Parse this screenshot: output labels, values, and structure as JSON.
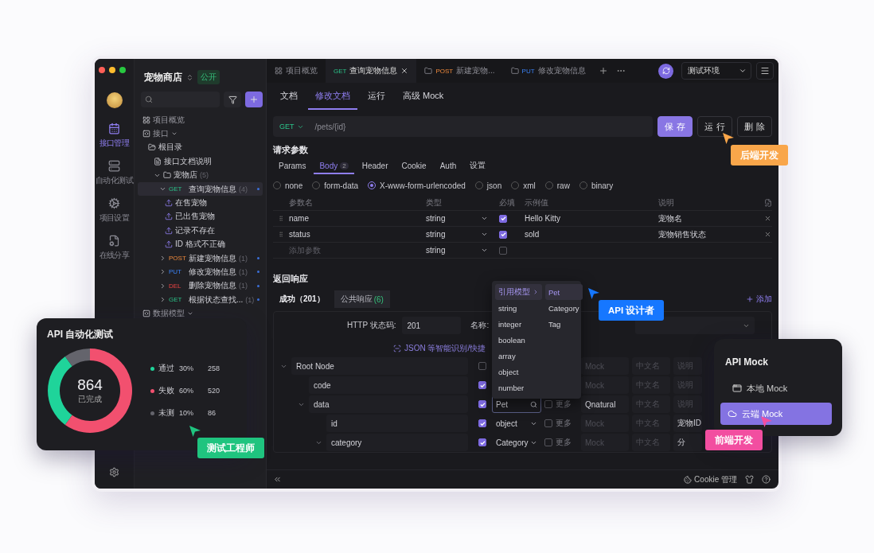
{
  "project": {
    "name": "宠物商店",
    "visibility": "公开"
  },
  "rail": [
    {
      "label": "接口管理",
      "selected": true
    },
    {
      "label": "自动化测试",
      "selected": false
    },
    {
      "label": "项目设置",
      "selected": false
    },
    {
      "label": "在线分享",
      "selected": false
    }
  ],
  "tree": [
    {
      "kind": "overview",
      "label": "项目概览"
    },
    {
      "kind": "section",
      "label": "接口",
      "children": [
        {
          "kind": "root",
          "label": "根目录",
          "children": [
            {
              "kind": "doc",
              "label": "接口文档说明"
            },
            {
              "kind": "folder",
              "label": "宠物店",
              "count": "(5)",
              "expanded": true,
              "children": [
                {
                  "kind": "api",
                  "method": "GET",
                  "label": "查询宠物信息",
                  "count": "(4)",
                  "expanded": true,
                  "selected": true,
                  "children": [
                    {
                      "kind": "case",
                      "label": "在售宠物"
                    },
                    {
                      "kind": "case",
                      "label": "已出售宠物"
                    },
                    {
                      "kind": "case",
                      "label": "记录不存在"
                    },
                    {
                      "kind": "case",
                      "label": "ID 格式不正确"
                    }
                  ]
                },
                {
                  "kind": "api",
                  "method": "POST",
                  "label": "新建宠物信息",
                  "count": "(1)",
                  "expanded": false,
                  "selected": false
                },
                {
                  "kind": "api",
                  "method": "PUT",
                  "label": "修改宠物信息",
                  "count": "(1)",
                  "expanded": false,
                  "selected": false
                },
                {
                  "kind": "api",
                  "method": "DEL",
                  "label": "删除宠物信息",
                  "count": "(1)",
                  "expanded": false,
                  "selected": false
                },
                {
                  "kind": "api",
                  "method": "GET",
                  "label": "根据状态查找...",
                  "count": "(1)",
                  "expanded": false,
                  "selected": false
                }
              ]
            }
          ]
        }
      ]
    },
    {
      "kind": "section",
      "label": "数据模型"
    }
  ],
  "tabs": [
    {
      "kind": "overview",
      "label": "项目概览",
      "selected": false
    },
    {
      "kind": "api",
      "method": "GET",
      "label": "查询宠物信息",
      "selected": true
    },
    {
      "kind": "folder",
      "method": "POST",
      "label": "新建宠物...",
      "selected": false
    },
    {
      "kind": "folder",
      "method": "PUT",
      "label": "修改宠物信息",
      "selected": false
    }
  ],
  "environment": "测试环境",
  "doc_tabs": [
    {
      "label": "文档",
      "selected": false
    },
    {
      "label": "修改文档",
      "selected": true
    },
    {
      "label": "运行",
      "selected": false
    },
    {
      "label": "高级 Mock",
      "selected": false
    }
  ],
  "request": {
    "method": "GET",
    "path": "/pets/{id}",
    "buttons": [
      {
        "label": "保 存",
        "kind": "primary"
      },
      {
        "label": "运 行",
        "kind": "default"
      },
      {
        "label": "删 除",
        "kind": "default"
      }
    ]
  },
  "request_params": {
    "title": "请求参数",
    "tabs": [
      {
        "label": "Params",
        "selected": false
      },
      {
        "label": "Body",
        "badge": "2",
        "selected": true
      },
      {
        "label": "Header",
        "selected": false
      },
      {
        "label": "Cookie",
        "selected": false
      },
      {
        "label": "Auth",
        "selected": false
      },
      {
        "label": "设置",
        "selected": false
      }
    ],
    "body_types": [
      {
        "label": "none",
        "selected": false
      },
      {
        "label": "form-data",
        "selected": false
      },
      {
        "label": "X-www-form-urlencoded",
        "selected": true
      },
      {
        "label": "json",
        "selected": false
      },
      {
        "label": "xml",
        "selected": false
      },
      {
        "label": "raw",
        "selected": false
      },
      {
        "label": "binary",
        "selected": false
      }
    ],
    "columns": [
      "参数名",
      "类型",
      "必填",
      "示例值",
      "说明"
    ],
    "rows": [
      {
        "name": "name",
        "type": "string",
        "required": true,
        "example": "Hello Kitty",
        "description": "宠物名"
      },
      {
        "name": "status",
        "type": "string",
        "required": true,
        "example": "sold",
        "description": "宠物销售状态"
      }
    ],
    "new_row": {
      "placeholder": "添加参数",
      "type": "string",
      "required": false
    }
  },
  "response": {
    "title": "返回响应",
    "tabs": [
      {
        "label": "成功（201）",
        "selected": true
      },
      {
        "label": "公共响应",
        "count": "(6)",
        "selected": false
      }
    ],
    "add_label": "添加",
    "status_label": "HTTP 状态码:",
    "status_value": "201",
    "name_label": "名称:",
    "import_hint": "JSON 等智能识别/快捷",
    "schema": [
      {
        "name": "Root Node",
        "expanded": true,
        "required": false,
        "mock_placeholder": "Mock",
        "cn_placeholder": "中文名",
        "desc_placeholder": "说明",
        "children": [
          {
            "name": "code",
            "required": true,
            "mock_placeholder": "Mock",
            "cn_placeholder": "中文名",
            "desc_placeholder": "说明"
          },
          {
            "name": "data",
            "expanded": true,
            "required": true,
            "type": {
              "kind": "search",
              "value": "Pet"
            },
            "more": {
              "label": "更多",
              "checked": false
            },
            "mock": "Qnatural",
            "cn_placeholder": "中文名",
            "desc_placeholder": "说明",
            "children": [
              {
                "name": "id",
                "required": true,
                "type": {
                  "kind": "select",
                  "value": "object"
                },
                "more": {
                  "label": "更多",
                  "checked": false
                },
                "mock_placeholder": "Mock",
                "cn_placeholder": "中文名",
                "desc": "宠物ID"
              },
              {
                "name": "category",
                "expanded": true,
                "required": true,
                "type": {
                  "kind": "select",
                  "value": "Category"
                },
                "more": {
                  "label": "更多",
                  "checked": false
                },
                "mock_placeholder": "Mock",
                "cn_placeholder": "中文名",
                "desc": "分"
              }
            ]
          }
        ]
      }
    ]
  },
  "type_menu": {
    "left": [
      {
        "label": "引用模型",
        "selected": true
      },
      {
        "label": "string",
        "selected": false
      },
      {
        "label": "integer",
        "selected": false
      },
      {
        "label": "boolean",
        "selected": false
      },
      {
        "label": "array",
        "selected": false
      },
      {
        "label": "object",
        "selected": false
      },
      {
        "label": "number",
        "selected": false
      }
    ],
    "right": [
      {
        "label": "Pet",
        "selected": true
      },
      {
        "label": "Category",
        "selected": false
      },
      {
        "label": "Tag",
        "selected": false
      }
    ]
  },
  "footer": {
    "cookie": "Cookie 管理"
  },
  "test_card": {
    "title": "API 自动化测试",
    "total": "864",
    "total_label": "已完成",
    "chart_data": {
      "type": "donut",
      "categories": [
        "通过",
        "失败",
        "未测"
      ],
      "values": [
        30,
        60,
        10
      ]
    },
    "legend": [
      {
        "percent": "30%",
        "count": "258",
        "color": "#1fd49a"
      },
      {
        "percent": "60%",
        "count": "520",
        "color": "#f2506f"
      },
      {
        "percent": "10%",
        "count": "86",
        "color": "#64646c"
      }
    ]
  },
  "mock_card": {
    "title": "API Mock",
    "items": [
      {
        "label": "本地 Mock",
        "selected": false
      },
      {
        "label": "云端 Mock",
        "selected": true
      }
    ]
  },
  "roles": [
    {
      "label": "后端开发",
      "color": "#f9a64a"
    },
    {
      "label": "API 设计者",
      "color": "#1677ff"
    },
    {
      "label": "测试工程师",
      "color": "#1fc47f"
    },
    {
      "label": "前端开发",
      "color": "#f24ea0"
    }
  ]
}
